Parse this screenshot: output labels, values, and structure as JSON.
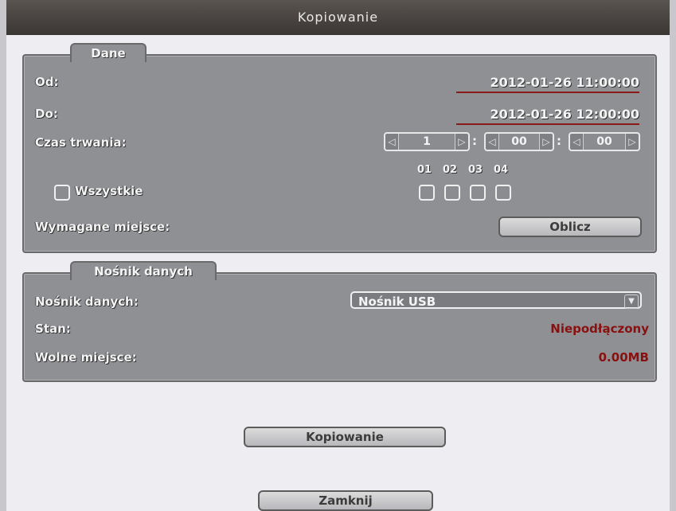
{
  "window": {
    "title": "Kopiowanie"
  },
  "dane": {
    "tab": "Dane",
    "od_label": "Od:",
    "od_value": "2012-01-26 11:00:00",
    "do_label": "Do:",
    "do_value": "2012-01-26 12:00:00",
    "czas_label": "Czas trwania:",
    "czas_hours": "1",
    "czas_minutes": "00",
    "czas_seconds": "00",
    "channels": [
      "01",
      "02",
      "03",
      "04"
    ],
    "wszystkie_label": "Wszystkie",
    "wymagane_label": "Wymagane miejsce:",
    "oblicz_button": "Oblicz"
  },
  "nosnik": {
    "tab": "Nośnik danych",
    "nosnik_label": "Nośnik danych:",
    "nosnik_value": "Nośnik USB",
    "stan_label": "Stan:",
    "stan_value": "Niepodłączony",
    "wolne_label": "Wolne miejsce:",
    "wolne_value": "0.00MB"
  },
  "actions": {
    "copy_button": "Kopiowanie",
    "close_button": "Zamknij"
  },
  "colors": {
    "status_red": "#8a1010",
    "panel": "#8e9094",
    "titlebar": "#3a3634"
  }
}
